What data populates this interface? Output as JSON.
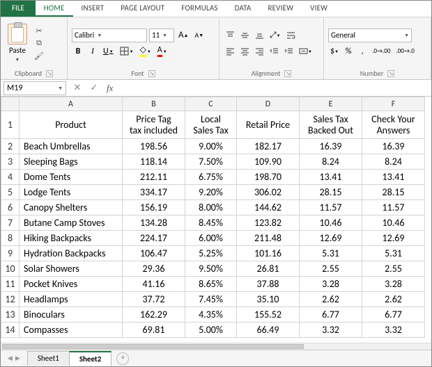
{
  "tabs": {
    "file": "FILE",
    "items": [
      "HOME",
      "INSERT",
      "PAGE LAYOUT",
      "FORMULAS",
      "DATA",
      "REVIEW",
      "VIEW"
    ],
    "active": 0
  },
  "ribbon": {
    "clipboard": {
      "paste": "Paste",
      "label": "Clipboard"
    },
    "font": {
      "name": "Calibri",
      "size": "11",
      "label": "Font"
    },
    "alignment": {
      "label": "Alignment"
    },
    "number": {
      "format": "General",
      "label": "Number"
    }
  },
  "namebox": "M19",
  "formula": "",
  "columns": [
    "A",
    "B",
    "C",
    "D",
    "E",
    "F"
  ],
  "headers": [
    "Product",
    "Price Tag\ntax included",
    "Local\nSales Tax",
    "Retail Price",
    "Sales Tax\nBacked Out",
    "Check Your\nAnswers"
  ],
  "rows": [
    {
      "n": 2,
      "c": [
        "Beach Umbrellas",
        "198.56",
        "9.00%",
        "182.17",
        "16.39",
        "16.39"
      ]
    },
    {
      "n": 3,
      "c": [
        "Sleeping Bags",
        "118.14",
        "7.50%",
        "109.90",
        "8.24",
        "8.24"
      ]
    },
    {
      "n": 4,
      "c": [
        "Dome Tents",
        "212.11",
        "6.75%",
        "198.70",
        "13.41",
        "13.41"
      ]
    },
    {
      "n": 5,
      "c": [
        "Lodge Tents",
        "334.17",
        "9.20%",
        "306.02",
        "28.15",
        "28.15"
      ]
    },
    {
      "n": 6,
      "c": [
        "Canopy Shelters",
        "156.19",
        "8.00%",
        "144.62",
        "11.57",
        "11.57"
      ]
    },
    {
      "n": 7,
      "c": [
        "Butane Camp Stoves",
        "134.28",
        "8.45%",
        "123.82",
        "10.46",
        "10.46"
      ]
    },
    {
      "n": 8,
      "c": [
        "Hiking Backpacks",
        "224.17",
        "6.00%",
        "211.48",
        "12.69",
        "12.69"
      ]
    },
    {
      "n": 9,
      "c": [
        "Hydration Backpacks",
        "106.47",
        "5.25%",
        "101.16",
        "5.31",
        "5.31"
      ]
    },
    {
      "n": 10,
      "c": [
        "Solar Showers",
        "29.36",
        "9.50%",
        "26.81",
        "2.55",
        "2.55"
      ]
    },
    {
      "n": 11,
      "c": [
        "Pocket Knives",
        "41.16",
        "8.65%",
        "37.88",
        "3.28",
        "3.28"
      ]
    },
    {
      "n": 12,
      "c": [
        "Headlamps",
        "37.72",
        "7.45%",
        "35.10",
        "2.62",
        "2.62"
      ]
    },
    {
      "n": 13,
      "c": [
        "Binoculars",
        "162.29",
        "4.35%",
        "155.52",
        "6.77",
        "6.77"
      ]
    },
    {
      "n": 14,
      "c": [
        "Compasses",
        "69.81",
        "5.00%",
        "66.49",
        "3.32",
        "3.32"
      ]
    }
  ],
  "sheets": {
    "items": [
      "Sheet1",
      "Sheet2"
    ],
    "active": 1
  }
}
